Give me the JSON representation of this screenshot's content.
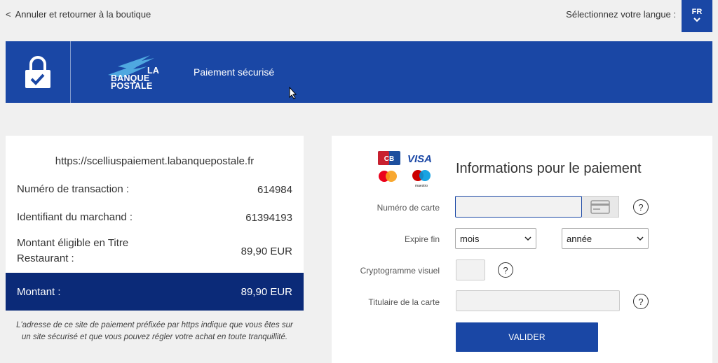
{
  "topbar": {
    "back_label": "Annuler et retourner à la boutique",
    "language_label": "Sélectionnez votre langue :",
    "language_code": "FR"
  },
  "banner": {
    "bank_name_line1": "LA",
    "bank_name_line2": "BANQUE",
    "bank_name_line3": "POSTALE",
    "title": "Paiement sécurisé"
  },
  "summary": {
    "url": "https://scelliuspaiement.labanquepostale.fr",
    "rows": [
      {
        "label": "Numéro de transaction :",
        "value": "614984"
      },
      {
        "label": "Identifiant du marchand :",
        "value": "61394193"
      },
      {
        "label": "Montant éligible en Titre Restaurant :",
        "value": "89,90 EUR"
      }
    ],
    "total_label": "Montant :",
    "total_value": "89,90 EUR",
    "notice": "L'adresse de ce site de paiement préfixée par https indique que vous êtes sur un site sécurisé et que vous pouvez régler votre achat en toute tranquillité."
  },
  "form": {
    "title": "Informations pour le paiement",
    "card_brands": {
      "cb": "CB",
      "visa": "VISA",
      "maestro": "maestro"
    },
    "card_number_label": "Numéro de carte",
    "card_number_value": "",
    "expiry_label": "Expire fin",
    "month_selected": "mois",
    "year_selected": "année",
    "cvv_label": "Cryptogramme visuel",
    "cvv_value": "",
    "holder_label": "Titulaire de la carte",
    "holder_value": "",
    "help_glyph": "?",
    "submit_label": "VALIDER"
  },
  "colors": {
    "primary": "#1a47a5",
    "dark": "#0b2a78",
    "background": "#f0f0f0"
  }
}
